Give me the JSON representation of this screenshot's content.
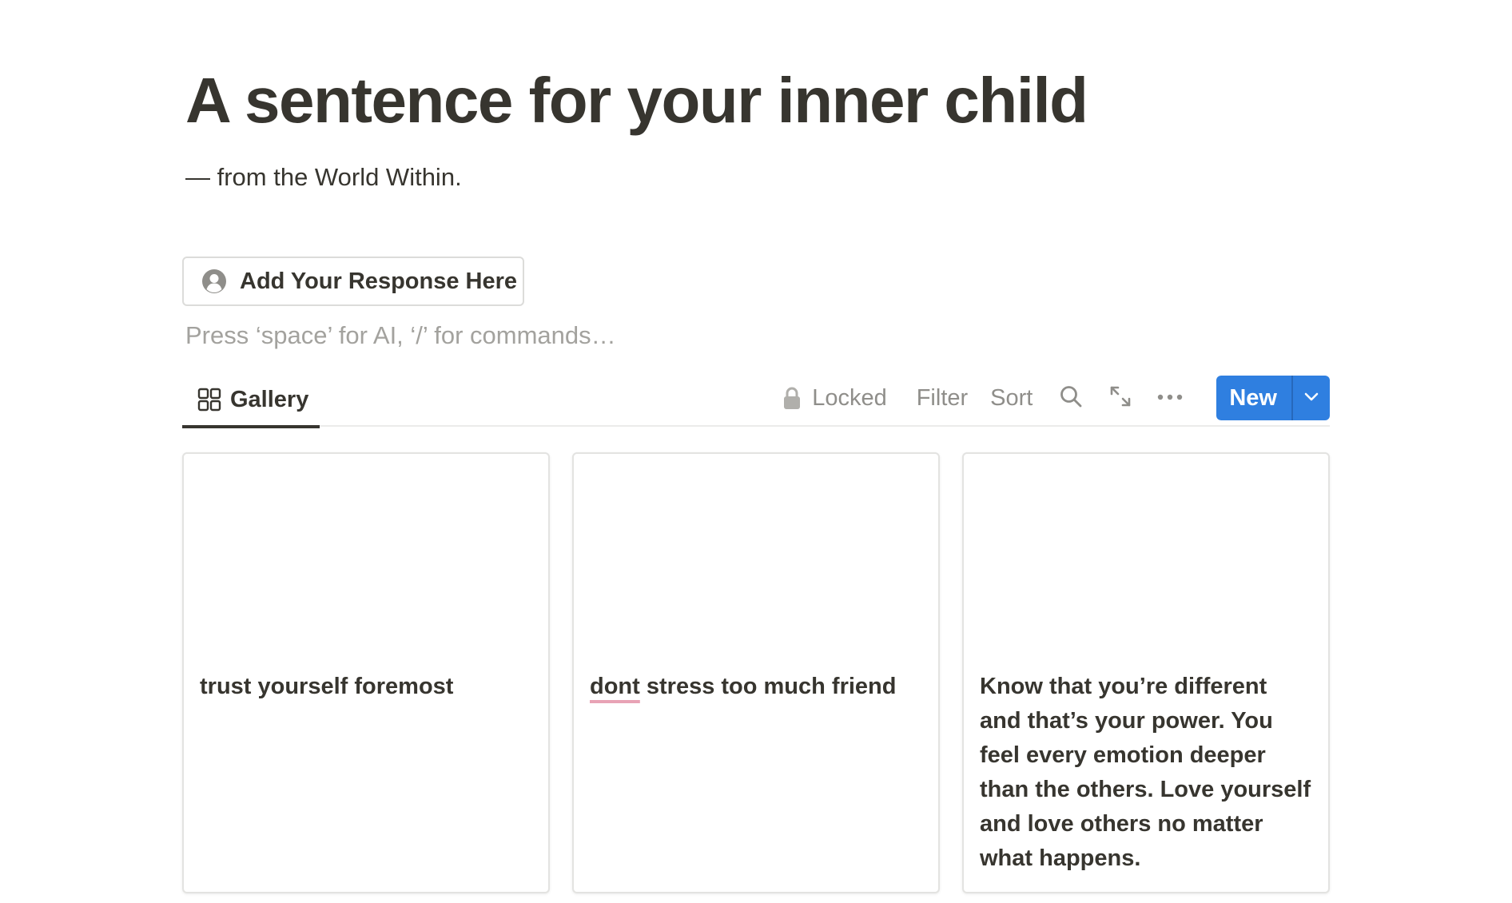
{
  "page": {
    "title": "A sentence for your inner child",
    "subtitle": "— from the World Within.",
    "response_button_label": "Add Your Response Here",
    "ai_placeholder": "Press ‘space’ for AI, ‘/’ for commands…"
  },
  "view": {
    "tab_label": "Gallery",
    "tab_icon": "gallery-grid-icon",
    "toolbar": {
      "locked_label": "Locked",
      "filter_label": "Filter",
      "sort_label": "Sort",
      "search_icon": "search-icon",
      "expand_icon": "expand-icon",
      "more_icon": "more-icon",
      "new_label": "New",
      "new_dropdown_icon": "chevron-down-icon"
    }
  },
  "cards": [
    {
      "text_plain": "trust yourself foremost"
    },
    {
      "misspelled_word": "dont",
      "text_rest": " stress too much friend"
    },
    {
      "text_plain": "Know that you’re different and that’s your power. You feel every emotion deeper than the others. Love yourself and love others no matter what happens."
    }
  ],
  "colors": {
    "accent": "#2f7fe0",
    "text": "#37352f",
    "muted": "#8f8e8a",
    "placeholder": "#a3a29e",
    "spellcheck_underline": "#e8a3b5"
  }
}
